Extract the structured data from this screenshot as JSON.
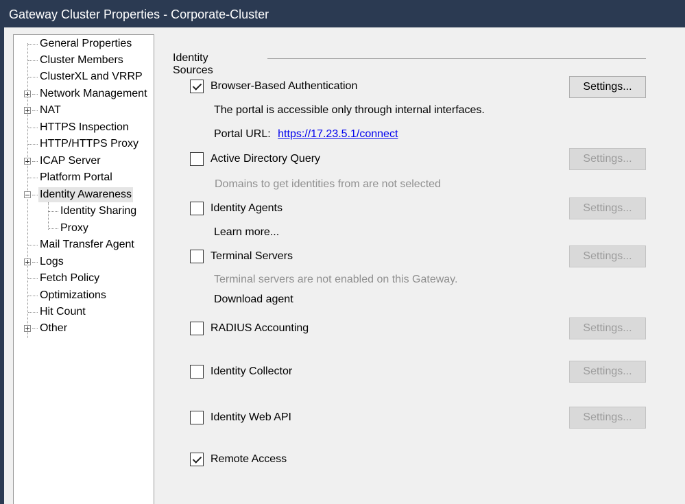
{
  "window": {
    "title": "Gateway Cluster Properties - Corporate-Cluster"
  },
  "tree": {
    "items": [
      {
        "label": "General Properties",
        "expander": null,
        "selected": false
      },
      {
        "label": "Cluster Members",
        "expander": null,
        "selected": false
      },
      {
        "label": "ClusterXL and VRRP",
        "expander": null,
        "selected": false
      },
      {
        "label": "Network Management",
        "expander": "plus",
        "selected": false
      },
      {
        "label": "NAT",
        "expander": "plus",
        "selected": false
      },
      {
        "label": "HTTPS Inspection",
        "expander": null,
        "selected": false
      },
      {
        "label": "HTTP/HTTPS Proxy",
        "expander": null,
        "selected": false
      },
      {
        "label": "ICAP Server",
        "expander": "plus",
        "selected": false
      },
      {
        "label": "Platform Portal",
        "expander": null,
        "selected": false
      },
      {
        "label": "Identity Awareness",
        "expander": "minus",
        "selected": true
      },
      {
        "label": "Identity Sharing",
        "expander": null,
        "selected": false,
        "child": true
      },
      {
        "label": "Proxy",
        "expander": null,
        "selected": false,
        "child": true
      },
      {
        "label": "Mail Transfer Agent",
        "expander": null,
        "selected": false
      },
      {
        "label": "Logs",
        "expander": "plus",
        "selected": false
      },
      {
        "label": "Fetch Policy",
        "expander": null,
        "selected": false
      },
      {
        "label": "Optimizations",
        "expander": null,
        "selected": false
      },
      {
        "label": "Hit Count",
        "expander": null,
        "selected": false
      },
      {
        "label": "Other",
        "expander": "plus",
        "selected": false
      }
    ]
  },
  "identity_sources": {
    "title": "Identity Sources",
    "browser_auth": {
      "label": "Browser-Based Authentication",
      "checked": true,
      "settings": "Settings...",
      "note": "The portal is accessible only through internal interfaces.",
      "portal_url_label": "Portal URL:",
      "portal_url": "https://17.23.5.1/connect"
    },
    "ad_query": {
      "label": "Active Directory Query",
      "checked": false,
      "settings": "Settings...",
      "note": "Domains to get identities from are not selected"
    },
    "identity_agents": {
      "label": "Identity Agents",
      "checked": false,
      "settings": "Settings...",
      "note": "Learn more..."
    },
    "terminal_servers": {
      "label": "Terminal Servers",
      "checked": false,
      "settings": "Settings...",
      "note": "Terminal servers are not enabled on this Gateway.",
      "download": "Download agent"
    },
    "radius": {
      "label": "RADIUS Accounting",
      "checked": false,
      "settings": "Settings..."
    },
    "collector": {
      "label": "Identity Collector",
      "checked": false,
      "settings": "Settings..."
    },
    "web_api": {
      "label": "Identity Web API",
      "checked": false,
      "settings": "Settings..."
    },
    "remote_access": {
      "label": "Remote Access",
      "checked": true
    }
  }
}
